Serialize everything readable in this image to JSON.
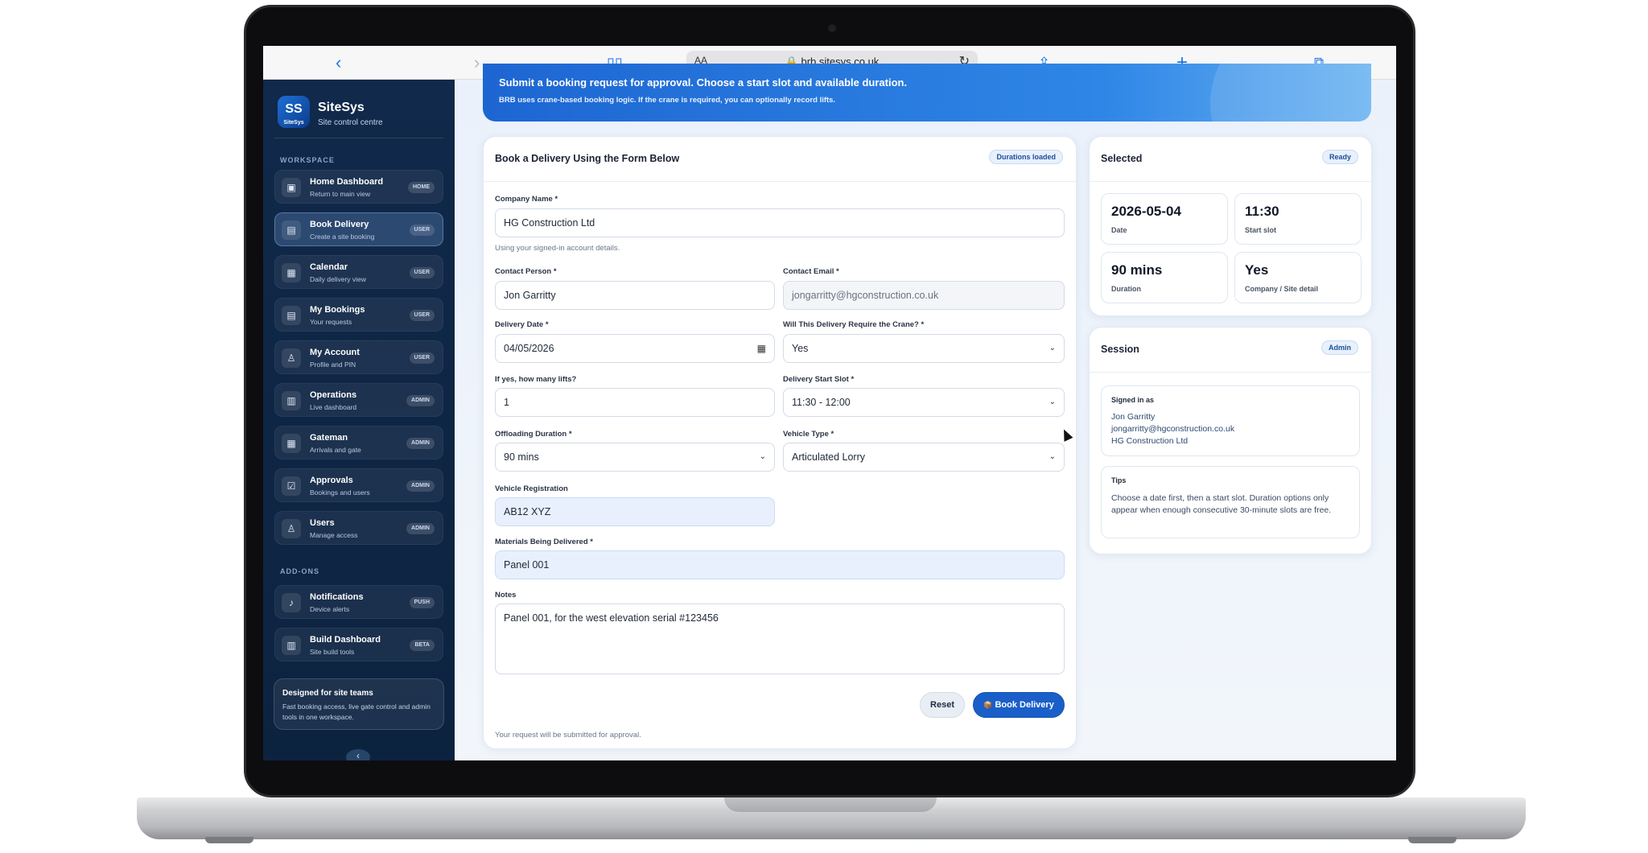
{
  "browser": {
    "url": "brb.sitesys.co.uk",
    "aa": "AA"
  },
  "brand": {
    "name": "SiteSys",
    "subtitle": "Site control centre",
    "logo_text": "SS",
    "logo_caption": "SiteSys"
  },
  "sidebar": {
    "workspace_label": "WORKSPACE",
    "addons_label": "ADD-ONS",
    "items": [
      {
        "title": "Home Dashboard",
        "sub": "Return to main view",
        "badge": "HOME",
        "icon": "▣"
      },
      {
        "title": "Book Delivery",
        "sub": "Create a site booking",
        "badge": "USER",
        "icon": "▤"
      },
      {
        "title": "Calendar",
        "sub": "Daily delivery view",
        "badge": "USER",
        "icon": "▦"
      },
      {
        "title": "My Bookings",
        "sub": "Your requests",
        "badge": "USER",
        "icon": "▤"
      },
      {
        "title": "My Account",
        "sub": "Profile and PIN",
        "badge": "USER",
        "icon": "♙"
      },
      {
        "title": "Operations",
        "sub": "Live dashboard",
        "badge": "ADMIN",
        "icon": "▥"
      },
      {
        "title": "Gateman",
        "sub": "Arrivals and gate",
        "badge": "ADMIN",
        "icon": "▦"
      },
      {
        "title": "Approvals",
        "sub": "Bookings and users",
        "badge": "ADMIN",
        "icon": "☑"
      },
      {
        "title": "Users",
        "sub": "Manage access",
        "badge": "ADMIN",
        "icon": "♙"
      }
    ],
    "addons": [
      {
        "title": "Notifications",
        "sub": "Device alerts",
        "badge": "PUSH",
        "icon": "♪"
      },
      {
        "title": "Build Dashboard",
        "sub": "Site build tools",
        "badge": "BETA",
        "icon": "▥"
      }
    ],
    "promo_title": "Designed for site teams",
    "promo_text": "Fast booking access, live gate control and admin tools in one workspace.",
    "collapse_icon": "‹"
  },
  "banner": {
    "title": "Submit a booking request for approval. Choose a start slot and available duration.",
    "subtitle": "BRB uses crane-based booking logic. If the crane is required, you can optionally record lifts."
  },
  "form": {
    "title": "Book a Delivery Using the Form Below",
    "status_pill": "Durations loaded",
    "company_label": "Company Name *",
    "company_value": "HG Construction Ltd",
    "account_hint": "Using your signed-in account details.",
    "contact_label": "Contact Person *",
    "contact_value": "Jon Garritty",
    "email_label": "Contact Email *",
    "email_value": "jongarritty@hgconstruction.co.uk",
    "date_label": "Delivery Date *",
    "date_value": "04/05/2026",
    "crane_label": "Will This Delivery Require the Crane? *",
    "crane_value": "Yes",
    "lifts_label": "If yes, how many lifts?",
    "lifts_value": "1",
    "slot_label": "Delivery Start Slot *",
    "slot_value": "11:30 - 12:00",
    "duration_label": "Offloading Duration *",
    "duration_value": "90 mins",
    "vehicle_type_label": "Vehicle Type *",
    "vehicle_type_value": "Articulated Lorry",
    "reg_label": "Vehicle Registration",
    "reg_value": "AB12 XYZ",
    "materials_label": "Materials Being Delivered *",
    "materials_value": "Panel 001",
    "notes_label": "Notes",
    "notes_value": "Panel 001, for the west elevation serial #123456",
    "reset_label": "Reset",
    "book_label": "Book Delivery",
    "book_icon": "📦",
    "footer_hint": "Your request will be submitted for approval."
  },
  "selected": {
    "title": "Selected",
    "pill": "Ready",
    "stats": [
      {
        "value": "2026-05-04",
        "key": "Date"
      },
      {
        "value": "11:30",
        "key": "Start slot"
      },
      {
        "value": "90 mins",
        "key": "Duration"
      },
      {
        "value": "Yes",
        "key": "Company / Site detail"
      }
    ]
  },
  "session": {
    "title": "Session",
    "pill": "Admin",
    "signed_in_label": "Signed in as",
    "user_name": "Jon Garritty",
    "user_email": "jongarritty@hgconstruction.co.uk",
    "user_company": "HG Construction Ltd",
    "tips_label": "Tips",
    "tips_text": "Choose a date first, then a start slot. Duration options only appear when enough consecutive 30-minute slots are free."
  }
}
